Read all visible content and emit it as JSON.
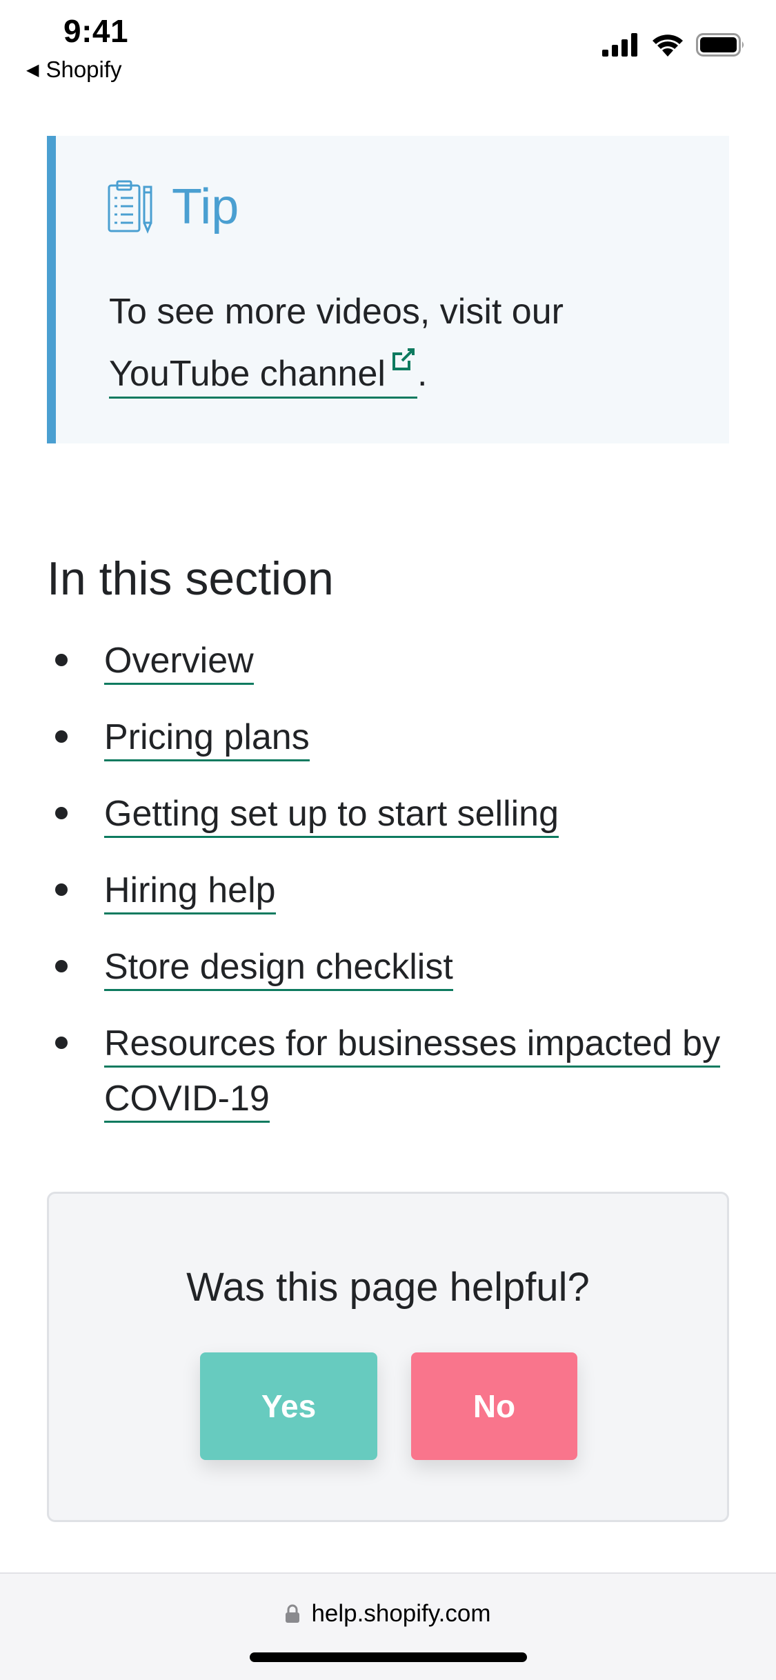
{
  "status_bar": {
    "time": "9:41",
    "back_app": "Shopify",
    "icons": [
      "signal-icon",
      "wifi-icon",
      "battery-icon"
    ]
  },
  "tip": {
    "icon": "clipboard-pen-icon",
    "title": "Tip",
    "text_before": "To see more videos, visit our",
    "link_text": "YouTube channel",
    "link_icon": "external-link-icon",
    "text_after": "."
  },
  "section": {
    "title": "In this section",
    "items": [
      {
        "label": "Overview"
      },
      {
        "label": "Pricing plans"
      },
      {
        "label": "Getting set up to start selling"
      },
      {
        "label": "Hiring help"
      },
      {
        "label": "Store design checklist"
      },
      {
        "label": "Resources for businesses impacted by COVID-19"
      }
    ]
  },
  "feedback": {
    "question": "Was this page helpful?",
    "yes_label": "Yes",
    "no_label": "No"
  },
  "browser": {
    "url": "help.shopify.com",
    "lock_icon": "lock-icon"
  },
  "colors": {
    "accent_blue": "#4a9fd1",
    "link_underline": "#0d7a5f",
    "yes_button": "#67cbbf",
    "no_button": "#f9758c",
    "tip_background": "#f4f8fb"
  }
}
